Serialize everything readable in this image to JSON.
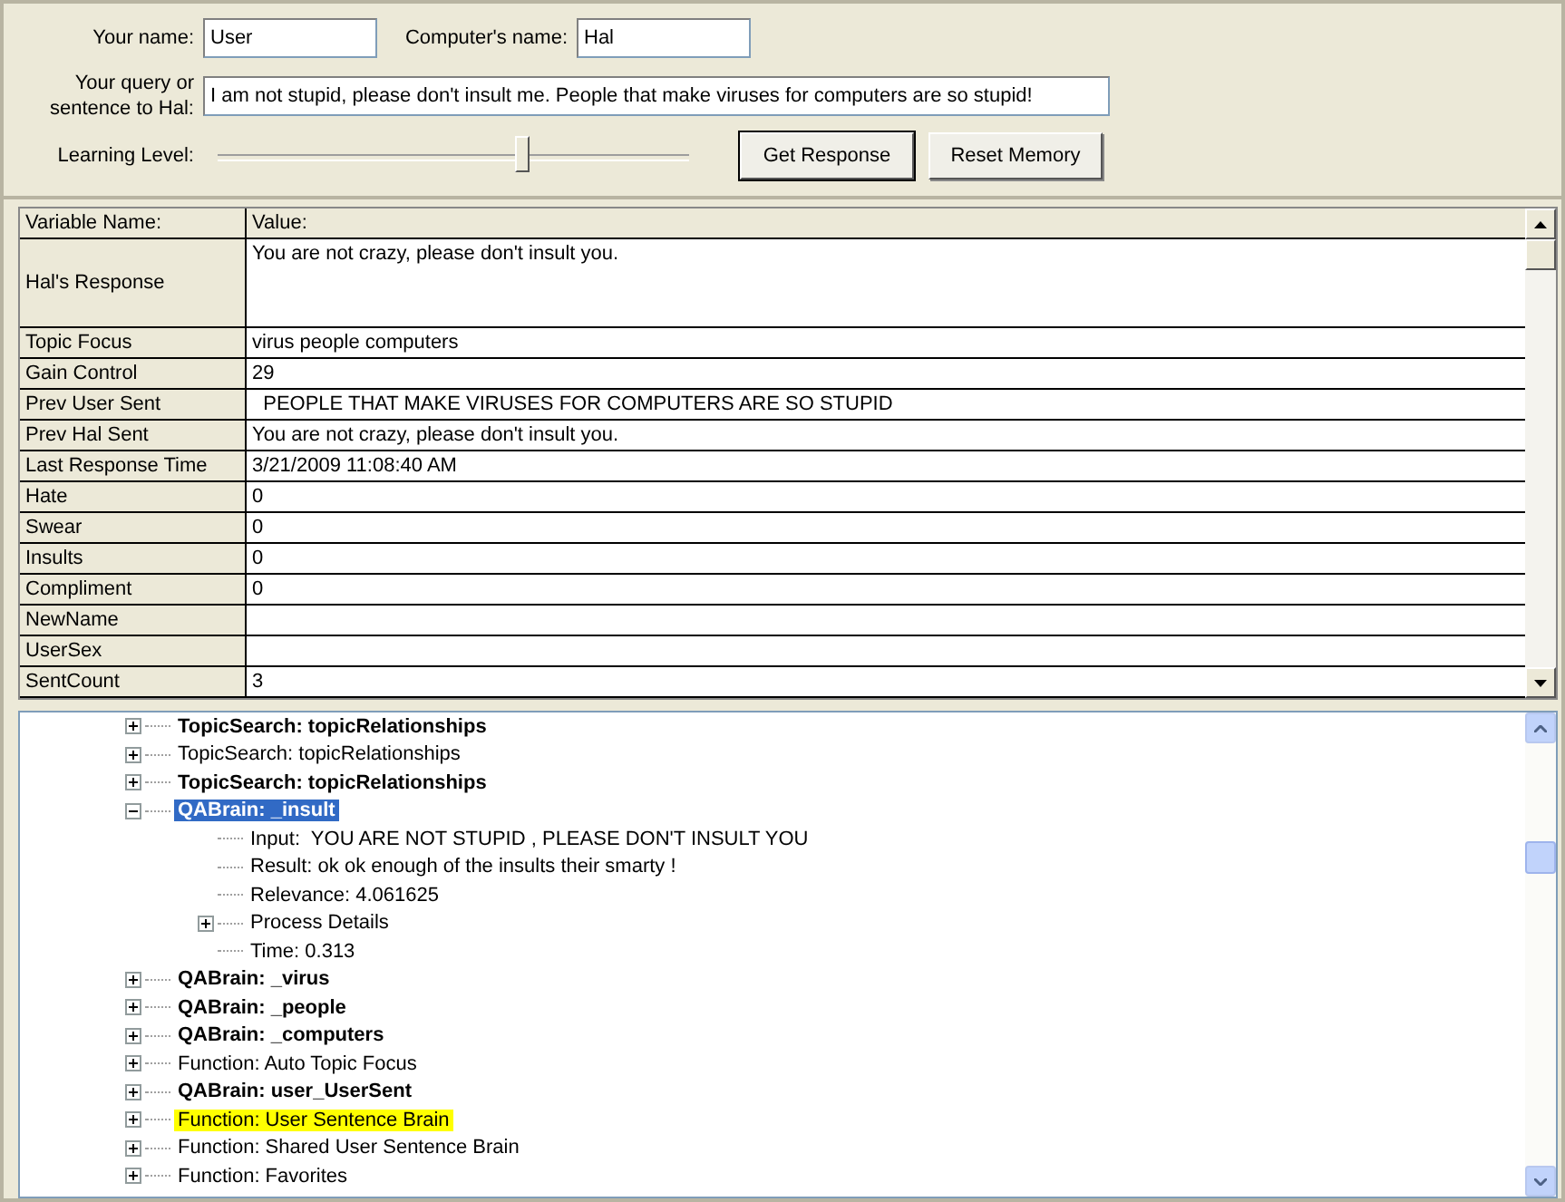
{
  "form": {
    "your_name_label": "Your name:",
    "your_name": "User",
    "computer_name_label": "Computer's name:",
    "computer_name": "Hal",
    "query_label": "Your query or sentence to Hal:",
    "query": "I am not stupid, please don't insult me. People that make viruses for computers are so stupid!",
    "learning_label": "Learning Level:",
    "learning_slider": {
      "level": 0.67
    },
    "buttons": [
      {
        "label": "Get Response",
        "selected": true
      },
      {
        "label": "Reset Memory",
        "selected": false
      }
    ]
  },
  "table": {
    "columns": [
      "Variable Name:",
      "Value:"
    ],
    "rows": [
      {
        "name": "Hal's Response",
        "value": "You are not crazy, please don't insult you.",
        "kind": "tall"
      },
      {
        "name": "Topic Focus",
        "value": "virus people computers",
        "kind": "line"
      },
      {
        "name": "Gain Control",
        "value": "29",
        "kind": "line"
      },
      {
        "name": "Prev User Sent",
        "value": "  PEOPLE THAT MAKE VIRUSES FOR COMPUTERS ARE SO STUPID",
        "kind": "line"
      },
      {
        "name": "Prev Hal Sent",
        "value": "You are not crazy, please don't insult you.",
        "kind": "line"
      },
      {
        "name": "Last Response Time",
        "value": "3/21/2009 11:08:40 AM",
        "kind": "line"
      },
      {
        "name": "Hate",
        "value": "0",
        "kind": "line"
      },
      {
        "name": "Swear",
        "value": "0",
        "kind": "line"
      },
      {
        "name": "Insults",
        "value": "0",
        "kind": "line"
      },
      {
        "name": "Compliment",
        "value": "0",
        "kind": "line"
      },
      {
        "name": "NewName",
        "value": "",
        "kind": "line"
      },
      {
        "name": "UserSex",
        "value": "",
        "kind": "line"
      },
      {
        "name": "SentCount",
        "value": "3",
        "kind": "line"
      }
    ]
  },
  "tree": {
    "items": [
      {
        "label": "TopicSearch: topicRelationships",
        "bold": true,
        "expanded": false,
        "selected": false,
        "highlighted": false
      },
      {
        "label": "TopicSearch: topicRelationships",
        "bold": false,
        "expanded": false,
        "selected": false,
        "highlighted": false
      },
      {
        "label": "TopicSearch: topicRelationships",
        "bold": true,
        "expanded": false,
        "selected": false,
        "highlighted": false
      },
      {
        "label": "QABrain: _insult",
        "bold": true,
        "expanded": true,
        "selected": true,
        "highlighted": false,
        "children": [
          {
            "label": "Input:  YOU ARE NOT STUPID , PLEASE DON'T INSULT YOU",
            "bold": false,
            "selected": false,
            "highlighted": false
          },
          {
            "label": "Result: ok ok enough of the insults their smarty !",
            "bold": false,
            "selected": false,
            "highlighted": false
          },
          {
            "label": "Relevance: 4.061625",
            "bold": false,
            "selected": false,
            "highlighted": false
          },
          {
            "label": "Process Details",
            "bold": false,
            "expanded": false,
            "selected": false,
            "highlighted": false
          },
          {
            "label": "Time: 0.313",
            "bold": false,
            "selected": false,
            "highlighted": false
          }
        ]
      },
      {
        "label": "QABrain: _virus",
        "bold": true,
        "expanded": false,
        "selected": false,
        "highlighted": false
      },
      {
        "label": "QABrain: _people",
        "bold": true,
        "expanded": false,
        "selected": false,
        "highlighted": false
      },
      {
        "label": "QABrain: _computers",
        "bold": true,
        "expanded": false,
        "selected": false,
        "highlighted": false
      },
      {
        "label": "Function: Auto Topic Focus",
        "bold": false,
        "expanded": false,
        "selected": false,
        "highlighted": false
      },
      {
        "label": "QABrain: user_UserSent",
        "bold": true,
        "expanded": false,
        "selected": false,
        "highlighted": false
      },
      {
        "label": "Function: User Sentence Brain",
        "bold": false,
        "expanded": false,
        "selected": false,
        "highlighted": true
      },
      {
        "label": "Function: Shared User Sentence Brain",
        "bold": false,
        "expanded": false,
        "selected": false,
        "highlighted": false
      },
      {
        "label": "Function: Favorites",
        "bold": false,
        "expanded": false,
        "selected": false,
        "highlighted": false
      }
    ]
  }
}
